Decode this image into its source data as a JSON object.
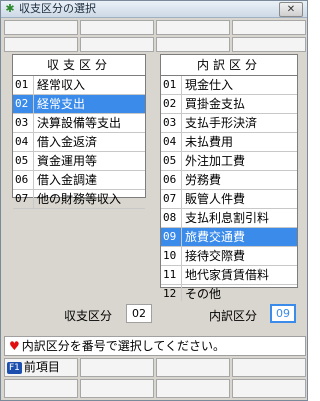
{
  "window": {
    "title": "収支区分の選択",
    "close_icon": "close-icon",
    "app_icon": "star-icon"
  },
  "income_panel": {
    "header": "収支区分",
    "items": [
      {
        "num": "01",
        "label": "経常収入"
      },
      {
        "num": "02",
        "label": "経常支出",
        "selected": true
      },
      {
        "num": "03",
        "label": "決算設備等支出"
      },
      {
        "num": "04",
        "label": "借入金返済"
      },
      {
        "num": "05",
        "label": "資金運用等"
      },
      {
        "num": "06",
        "label": "借入金調達"
      },
      {
        "num": "07",
        "label": "他の財務等収入"
      }
    ]
  },
  "detail_panel": {
    "header": "内訳区分",
    "items": [
      {
        "num": "01",
        "label": "現金仕入"
      },
      {
        "num": "02",
        "label": "買掛金支払"
      },
      {
        "num": "03",
        "label": "支払手形決済"
      },
      {
        "num": "04",
        "label": "未払費用"
      },
      {
        "num": "05",
        "label": "外注加工費"
      },
      {
        "num": "06",
        "label": "労務費"
      },
      {
        "num": "07",
        "label": "販管人件費"
      },
      {
        "num": "08",
        "label": "支払利息割引料"
      },
      {
        "num": "09",
        "label": "旅費交通費",
        "selected": true
      },
      {
        "num": "10",
        "label": "接待交際費"
      },
      {
        "num": "11",
        "label": "地代家賃賃借料"
      },
      {
        "num": "12",
        "label": "その他"
      }
    ]
  },
  "status": {
    "income_label": "収支区分",
    "income_value": "02",
    "detail_label": "内訳区分",
    "detail_value": "09"
  },
  "message": "内訳区分を番号で選択してください。",
  "bottom": {
    "f1_key": "F1",
    "f1_label": "前項目"
  }
}
